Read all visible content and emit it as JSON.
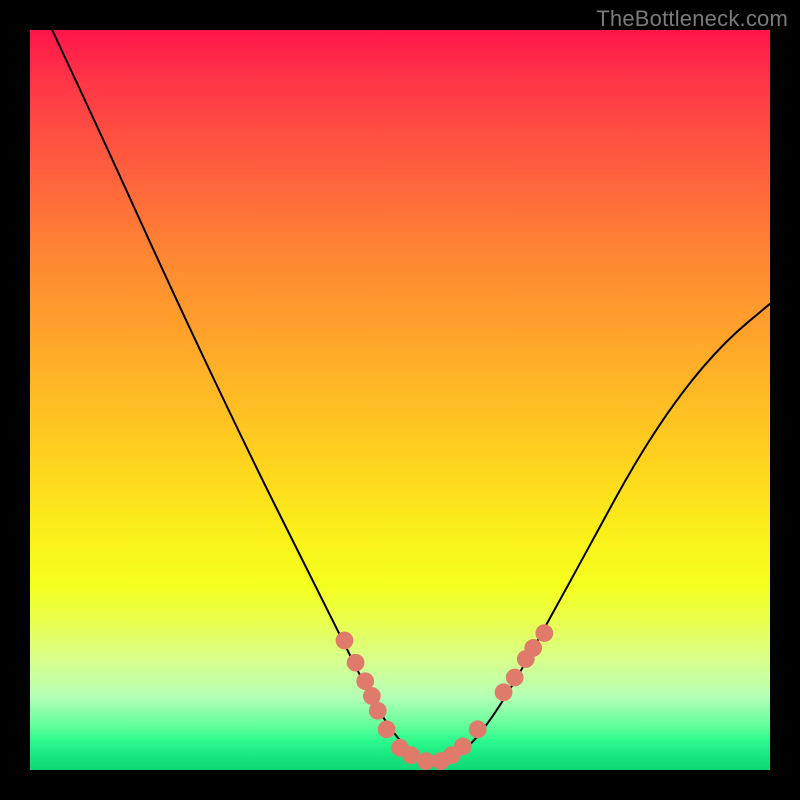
{
  "watermark": "TheBottleneck.com",
  "chart_data": {
    "type": "line",
    "title": "",
    "xlabel": "",
    "ylabel": "",
    "xlim": [
      0,
      100
    ],
    "ylim": [
      0,
      100
    ],
    "grid": false,
    "legend": false,
    "series": [
      {
        "name": "curve",
        "color": "#000000",
        "x": [
          3,
          10,
          20,
          30,
          37,
          42,
          46,
          49,
          52,
          55,
          58,
          61,
          65,
          70,
          76,
          82,
          88,
          94,
          100
        ],
        "y": [
          100,
          85,
          63,
          42,
          28,
          18,
          10,
          5,
          2,
          1,
          2,
          5,
          11,
          20,
          31,
          42,
          51,
          58,
          63
        ]
      }
    ],
    "highlights": [
      {
        "name": "dots",
        "color": "#e07a6a",
        "r": 1.2,
        "points": [
          {
            "x": 42.5,
            "y": 17.5
          },
          {
            "x": 44.0,
            "y": 14.5
          },
          {
            "x": 45.3,
            "y": 12.0
          },
          {
            "x": 46.2,
            "y": 10.0
          },
          {
            "x": 47.0,
            "y": 8.0
          },
          {
            "x": 48.2,
            "y": 5.5
          },
          {
            "x": 50.0,
            "y": 3.0
          },
          {
            "x": 51.5,
            "y": 2.0
          },
          {
            "x": 53.5,
            "y": 1.2
          },
          {
            "x": 55.5,
            "y": 1.2
          },
          {
            "x": 57.0,
            "y": 2.0
          },
          {
            "x": 58.5,
            "y": 3.2
          },
          {
            "x": 60.5,
            "y": 5.5
          },
          {
            "x": 64.0,
            "y": 10.5
          },
          {
            "x": 65.5,
            "y": 12.5
          },
          {
            "x": 67.0,
            "y": 15.0
          },
          {
            "x": 68.0,
            "y": 16.5
          },
          {
            "x": 69.5,
            "y": 18.5
          }
        ]
      }
    ]
  }
}
